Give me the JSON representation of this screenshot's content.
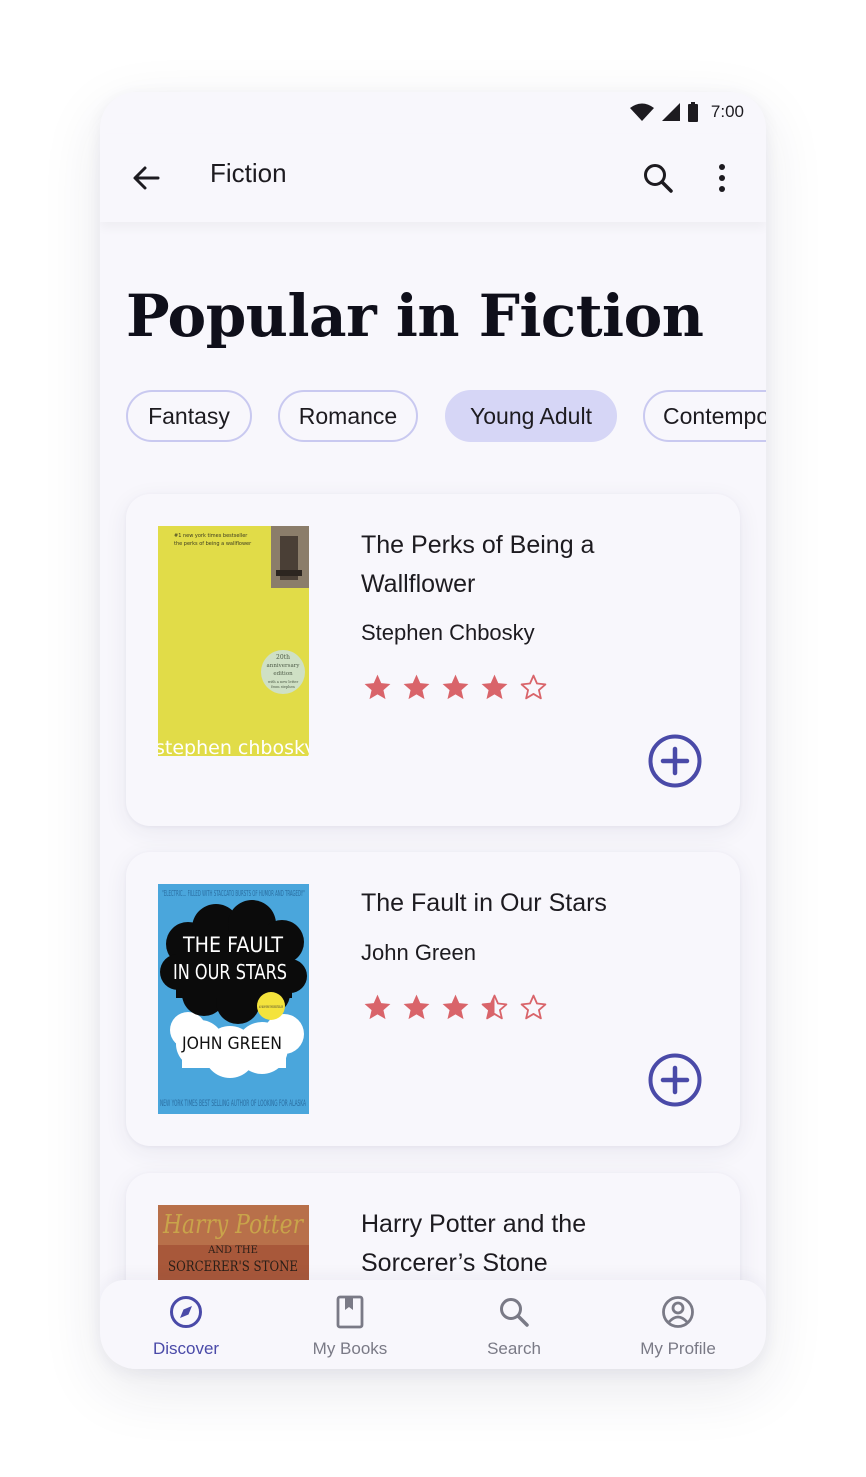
{
  "status_bar": {
    "time": "7:00",
    "icons": [
      "wifi-icon",
      "signal-icon",
      "battery-icon"
    ]
  },
  "app_bar": {
    "title": "Fiction",
    "icons": [
      "back-arrow-icon",
      "search-icon",
      "more-vert-icon"
    ]
  },
  "heading": "Popular in Fiction",
  "chips": [
    {
      "label": "Fantasy",
      "selected": false
    },
    {
      "label": "Romance",
      "selected": false
    },
    {
      "label": "Young Adult",
      "selected": true
    },
    {
      "label": "Contempo",
      "selected": false
    }
  ],
  "books": [
    {
      "title": "The Perks of Being a Wallflower",
      "author": "Stephen Chbosky",
      "rating": 4,
      "cover": {
        "bg": "#e1dc48",
        "tagline": "#1 new york times bestseller",
        "subtitle": "the perks of being a wallflower",
        "badge": [
          "20th",
          "anniversary",
          "edition",
          "with a new letter",
          "from stephen"
        ],
        "author_text": "stephen chbosky"
      }
    },
    {
      "title": "The Fault in Our Stars",
      "author": "John Green",
      "rating": 3.5,
      "cover": {
        "bg": "#4aa6dc",
        "quote": "\"ELECTRIC... FILLED WITH STACCATO BURSTS OF HUMOR AND TRAGEDY\"",
        "title_line1": "THE FAULT",
        "title_line2": "IN OUR STARS",
        "badge": "#1 NEW YORK TIMES BESTSELLER",
        "author_text": "JOHN GREEN",
        "bottom_text": "NEW YORK TIMES BEST SELLING AUTHOR OF LOOKING FOR ALASKA"
      }
    },
    {
      "title": "Harry Potter and the Sorcerer’s Stone",
      "author": "",
      "cover": {
        "bg": "#a8583a",
        "title_text": "Harry Potter",
        "sub1": "AND THE",
        "sub2": "SORCERER'S STONE"
      }
    }
  ],
  "bottom_nav": [
    {
      "label": "Discover",
      "icon": "compass-icon",
      "active": true
    },
    {
      "label": "My Books",
      "icon": "bookmark-book-icon",
      "active": false
    },
    {
      "label": "Search",
      "icon": "search-icon",
      "active": false
    },
    {
      "label": "My Profile",
      "icon": "profile-icon",
      "active": false
    }
  ],
  "colors": {
    "accent": "#4a4aa8",
    "star": "#d9646a",
    "chip_selected": "#d6d6f6",
    "chip_border": "#c9c9f0"
  }
}
